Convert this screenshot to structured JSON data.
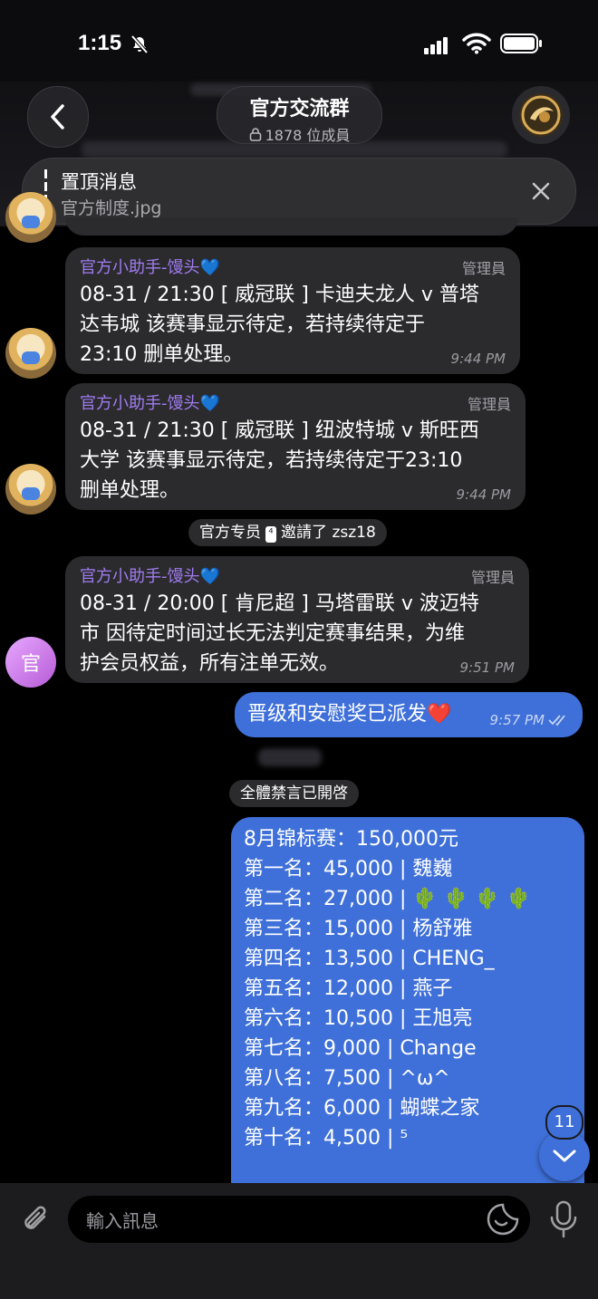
{
  "status_bar": {
    "time": "1:15"
  },
  "header": {
    "title": "官方交流群",
    "members": "1878 位成員"
  },
  "pinned": {
    "title": "置頂消息",
    "subtitle": "官方制度.jpg"
  },
  "messages": [
    {
      "sender": "官方小助手-馒头",
      "role": "管理員",
      "lines": [
        "08-31 / 21:30 [ 威冠联 ] 卡迪夫龙人 v 普塔",
        "达韦城 该赛事显示待定，若持续待定于",
        "23:10 删单处理。"
      ],
      "time": "9:44 PM"
    },
    {
      "sender": "官方小助手-馒头",
      "role": "管理員",
      "lines": [
        "08-31 / 21:30 [ 威冠联 ] 纽波特城 v 斯旺西",
        "大学 该赛事显示待定，若持续待定于23:10",
        "删单处理。"
      ],
      "time": "9:44 PM"
    },
    {
      "sender": "官方小助手-馒头",
      "role": "管理員",
      "lines": [
        "08-31 / 20:00 [ 肯尼超 ] 马塔雷联 v 波迈特",
        "市 因待定时间过长无法判定赛事结果，为维",
        "护会员权益，所有注单无效。"
      ],
      "time": "9:51 PM"
    }
  ],
  "service_invite": {
    "actor": "官方专员",
    "badge": "⁴",
    "action": "邀請了",
    "target": "zsz18"
  },
  "outgoing": {
    "text": "晋级和安慰奖已派发",
    "emoji": "❤️",
    "time": "9:57 PM"
  },
  "service_mute": "全體禁言已開啓",
  "tournament": {
    "lines": [
      "8月锦标赛：150,000元",
      "第一名：45,000 | 魏巍",
      "第二名：27,000 | 🌵 🌵 🌵 🌵",
      "第三名：15,000 | 杨舒雅",
      "第四名：13,500 | CHENG_",
      "第五名：12,000 | 燕子",
      "第六名：10,500 | 王旭亮",
      "第七名：9,000 | Change",
      "第八名：7,500 | ^ω^",
      "第九名：6,000 | 蝴蝶之家",
      "第十名：4,500 | ⁵"
    ]
  },
  "scroll_badge": "11",
  "input": {
    "placeholder": "輸入訊息"
  },
  "avatar_guan_label": "官",
  "heart_emoji": "💙",
  "colors": {
    "accent": "#3f70d9",
    "sender": "#a07cf0",
    "bubble_in": "#2b2b2e"
  }
}
